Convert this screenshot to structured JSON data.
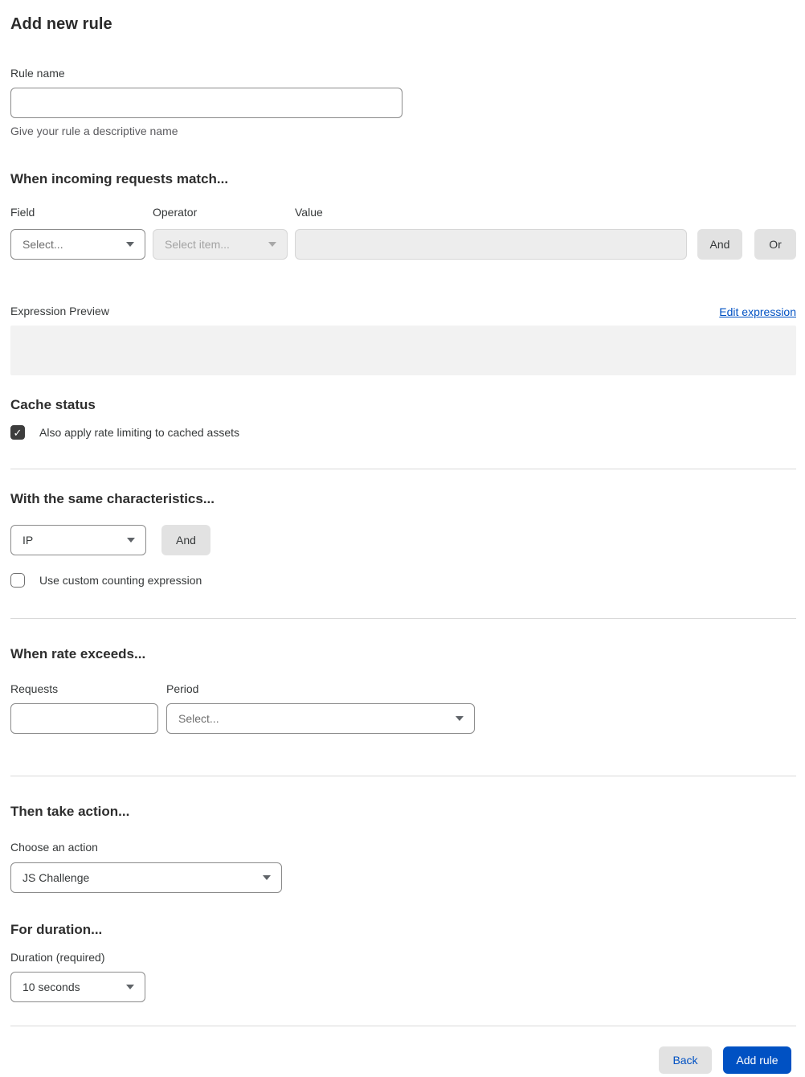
{
  "page": {
    "title": "Add new rule"
  },
  "rule_name": {
    "label": "Rule name",
    "value": "",
    "helper": "Give your rule a descriptive name"
  },
  "match": {
    "heading": "When incoming requests match...",
    "field_label": "Field",
    "field_value": "Select...",
    "operator_label": "Operator",
    "operator_value": "Select item...",
    "value_label": "Value",
    "value_value": "",
    "and_label": "And",
    "or_label": "Or",
    "preview_label": "Expression Preview",
    "edit_link": "Edit expression",
    "preview_value": ""
  },
  "cache": {
    "heading": "Cache status",
    "checkbox_label": "Also apply rate limiting to cached assets",
    "checked": true,
    "check_glyph": "✓"
  },
  "characteristics": {
    "heading": "With the same characteristics...",
    "select_value": "IP",
    "and_label": "And",
    "checkbox_label": "Use custom counting expression",
    "checked": false
  },
  "rate": {
    "heading": "When rate exceeds...",
    "requests_label": "Requests",
    "requests_value": "",
    "period_label": "Period",
    "period_value": "Select..."
  },
  "action": {
    "heading": "Then take action...",
    "label": "Choose an action",
    "value": "JS Challenge"
  },
  "duration": {
    "heading": "For duration...",
    "label": "Duration (required)",
    "value": "10 seconds"
  },
  "footer": {
    "back_label": "Back",
    "add_label": "Add rule"
  },
  "colors": {
    "accent_blue": "#0051c3",
    "checkbox_dark": "#3d3d3d",
    "preview_bg": "#f2f2f2"
  }
}
